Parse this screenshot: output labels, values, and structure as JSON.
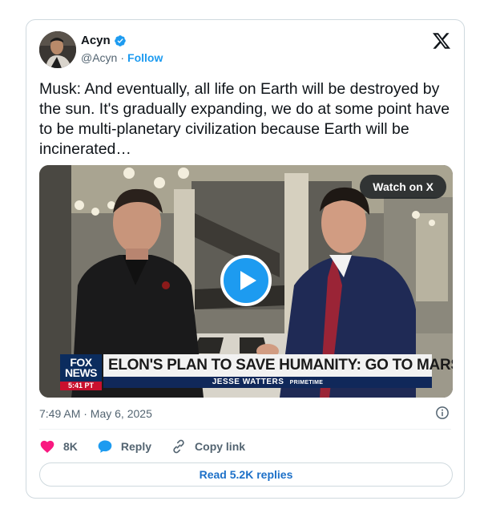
{
  "author": {
    "name": "Acyn",
    "handle": "@Acyn",
    "separator": "·",
    "follow_label": "Follow"
  },
  "tweet": {
    "text": "Musk: And eventually, all life on Earth will be destroyed by the sun. It's gradually expanding, we do at some point have to be multi-planetary civilization because Earth will be incinerated…",
    "timestamp": "7:49 AM · May 6, 2025"
  },
  "media": {
    "watch_label": "Watch on X",
    "network_logo_top": "FOX",
    "network_logo_bottom": "NEWS",
    "network_time": "5:41 PT",
    "headline": "ELON'S PLAN TO SAVE HUMANITY: GO TO MARS",
    "show_name": "JESSE WATTERS",
    "show_suffix": "PRIMETIME"
  },
  "actions": {
    "likes": "8K",
    "reply_label": "Reply",
    "copy_link_label": "Copy link"
  },
  "read_replies_label": "Read 5.2K replies",
  "colors": {
    "accent": "#1d9bf0",
    "like": "#f91880",
    "link_text": "#1d70c8",
    "muted": "#536471"
  },
  "icons": [
    "verified-badge-icon",
    "x-logo-icon",
    "play-icon",
    "info-icon",
    "heart-icon",
    "reply-bubble-icon",
    "link-icon"
  ]
}
